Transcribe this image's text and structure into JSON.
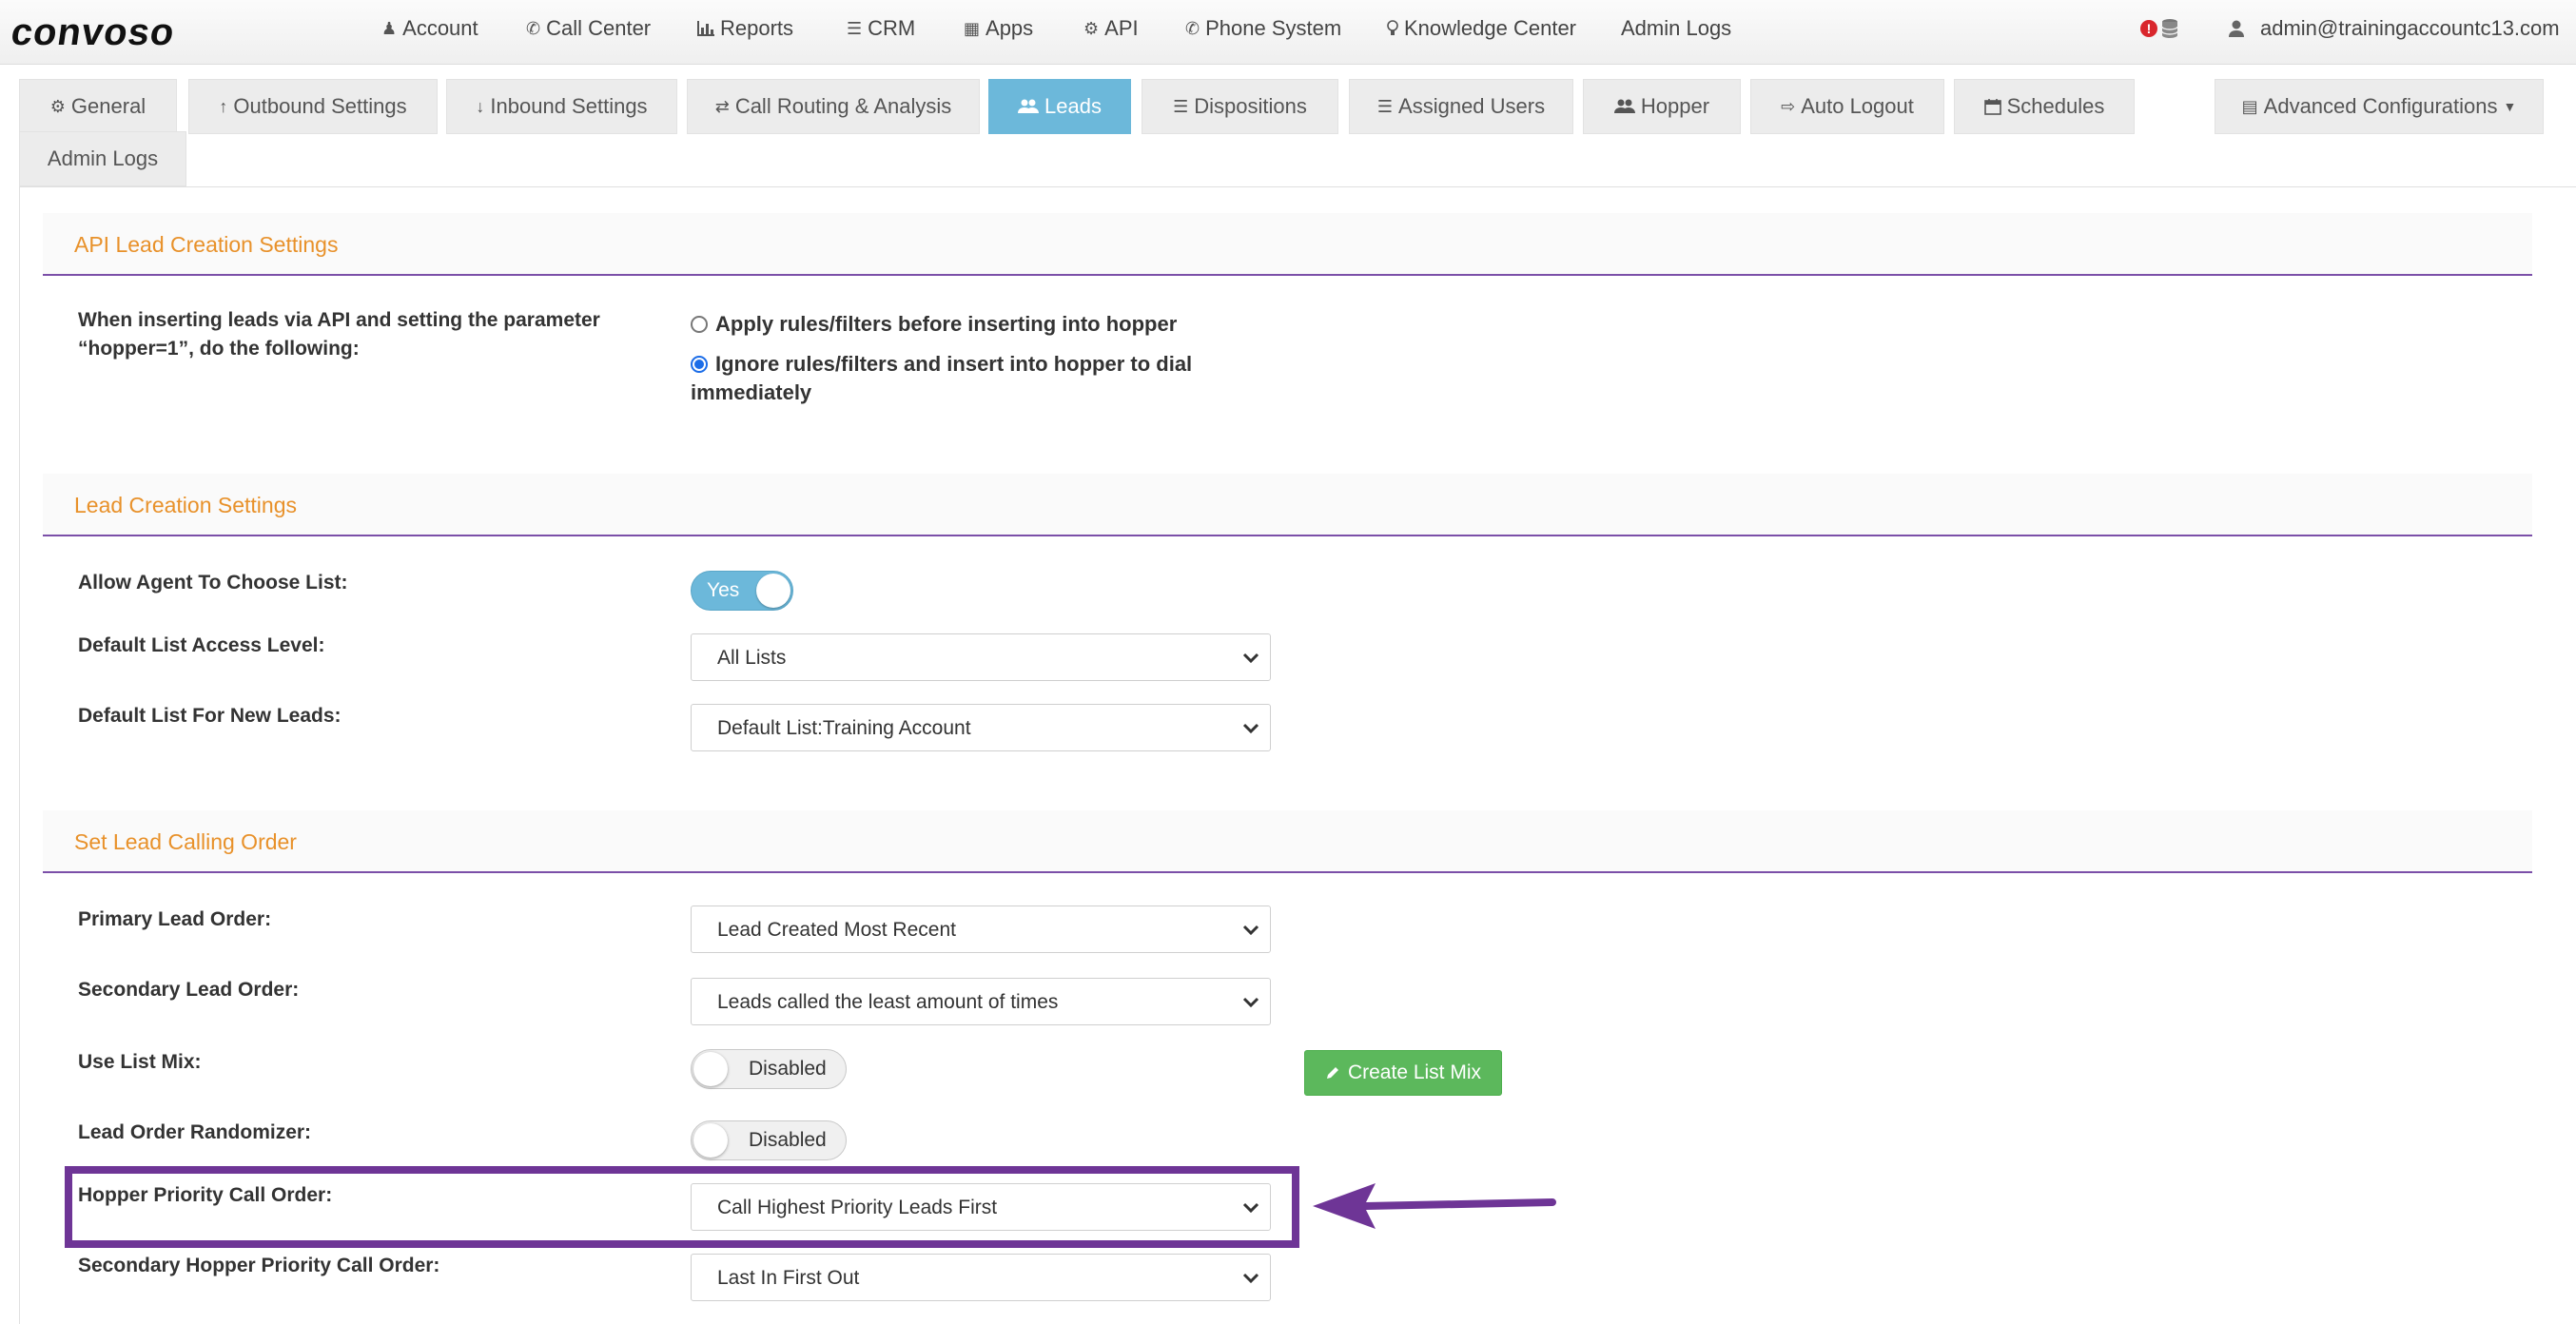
{
  "brand": "convoso",
  "topnav": {
    "items": [
      {
        "label": "Account",
        "icon": "user-icon"
      },
      {
        "label": "Call Center",
        "icon": "phone-icon"
      },
      {
        "label": "Reports",
        "icon": "bar-chart-icon"
      },
      {
        "label": "CRM",
        "icon": "list-icon"
      },
      {
        "label": "Apps",
        "icon": "grid-icon"
      },
      {
        "label": "API",
        "icon": "gear-icon"
      },
      {
        "label": "Phone System",
        "icon": "phone-icon"
      },
      {
        "label": "Knowledge Center",
        "icon": "lightbulb-icon"
      },
      {
        "label": "Admin Logs",
        "icon": ""
      }
    ],
    "alert_badge": "!",
    "user_email": "admin@trainingaccountc13.com"
  },
  "tabs": [
    {
      "label": "General",
      "icon": "gears-icon"
    },
    {
      "label": "Outbound Settings",
      "icon": "arrow-up-icon"
    },
    {
      "label": "Inbound Settings",
      "icon": "arrow-down-icon"
    },
    {
      "label": "Call Routing & Analysis",
      "icon": "shuffle-icon"
    },
    {
      "label": "Leads",
      "icon": "users-icon",
      "active": true
    },
    {
      "label": "Dispositions",
      "icon": "list-icon"
    },
    {
      "label": "Assigned Users",
      "icon": "ordered-list-icon"
    },
    {
      "label": "Hopper",
      "icon": "users-icon"
    },
    {
      "label": "Auto Logout",
      "icon": "sign-out-icon"
    },
    {
      "label": "Schedules",
      "icon": "calendar-icon"
    },
    {
      "label": "Advanced Configurations",
      "icon": "list-alt-icon"
    }
  ],
  "tab_row2": "Admin Logs",
  "sections": {
    "api": {
      "title": "API Lead Creation Settings",
      "label": "When inserting leads via API and setting the parameter “hopper=1”, do the following:",
      "option1": "Apply rules/filters before inserting into hopper",
      "option2": "Ignore rules/filters and insert into hopper to dial immediately",
      "selected": 2
    },
    "lead_creation": {
      "title": "Lead Creation Settings",
      "allow_agent_label": "Allow Agent To Choose List:",
      "allow_agent_value": "Yes",
      "default_access_label": "Default List Access Level:",
      "default_access_value": "All Lists",
      "default_list_label": "Default List For New Leads:",
      "default_list_value": "Default List:Training Account"
    },
    "calling_order": {
      "title": "Set Lead Calling Order",
      "primary_label": "Primary Lead Order:",
      "primary_value": "Lead Created Most Recent",
      "secondary_label": "Secondary Lead Order:",
      "secondary_value": "Leads called the least amount of times",
      "list_mix_label": "Use List Mix:",
      "list_mix_value": "Disabled",
      "create_list_mix": "Create List Mix",
      "randomizer_label": "Lead Order Randomizer:",
      "randomizer_value": "Disabled",
      "hopper_priority_label": "Hopper Priority Call Order:",
      "hopper_priority_value": "Call Highest Priority Leads First",
      "secondary_hopper_label": "Secondary Hopper Priority Call Order:",
      "secondary_hopper_value": "Last In First Out"
    }
  },
  "colors": {
    "accent_tab": "#6cb8da",
    "section_title": "#e8912a",
    "section_rule": "#7b4fa8",
    "highlight": "#6e3596",
    "button_green": "#5cb85c"
  }
}
